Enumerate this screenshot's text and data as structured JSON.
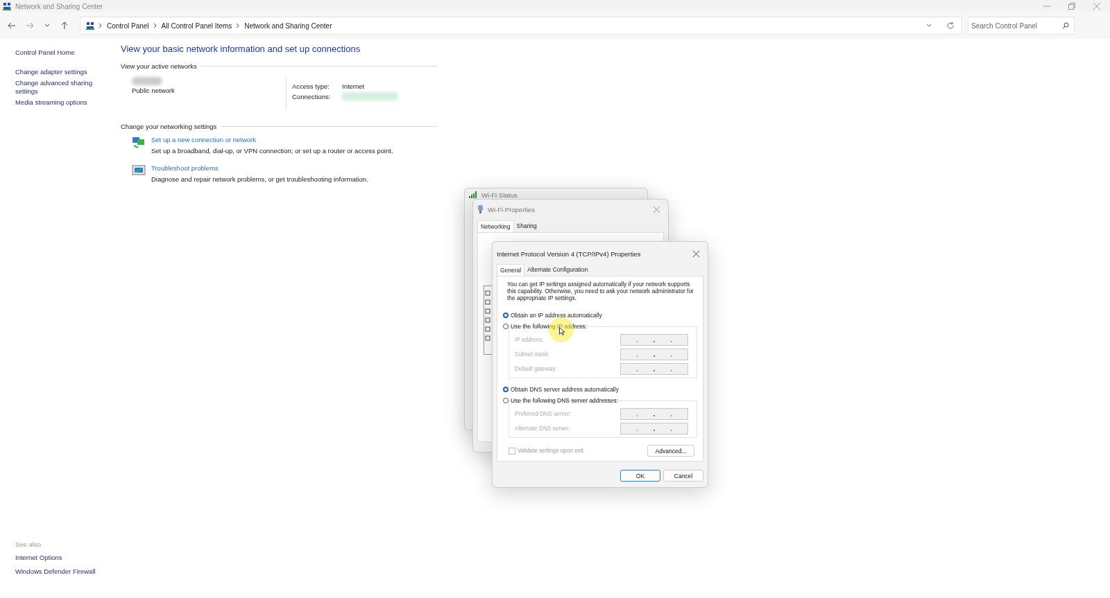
{
  "window": {
    "title": "Network and Sharing Center"
  },
  "address_bar": {
    "breadcrumbs": [
      "Control Panel",
      "All Control Panel Items",
      "Network and Sharing Center"
    ],
    "search": {
      "placeholder": "Search Control Panel"
    }
  },
  "sidebar": {
    "items": [
      {
        "label": "Control Panel Home"
      },
      {
        "label": "Change adapter settings"
      },
      {
        "label": "Change advanced sharing settings"
      },
      {
        "label": "Media streaming options"
      }
    ],
    "see_also": {
      "heading": "See also",
      "items": [
        {
          "label": "Internet Options"
        },
        {
          "label": "Windows Defender Firewall"
        }
      ]
    }
  },
  "main": {
    "heading": "View your basic network information and set up connections",
    "active_networks": {
      "label": "View your active networks",
      "network_type": "Public network",
      "access_type_label": "Access type:",
      "access_type": "Internet",
      "connections_label": "Connections:"
    },
    "change_settings": {
      "label": "Change your networking settings",
      "tasks": [
        {
          "kind": "connection",
          "title": "Set up a new connection or network",
          "description": "Set up a broadband, dial-up, or VPN connection; or set up a router or access point."
        },
        {
          "kind": "troubleshoot",
          "title": "Troubleshoot problems",
          "description": "Diagnose and repair network problems, or get troubleshooting information."
        }
      ]
    }
  },
  "wifi_status": {
    "title": "Wi-Fi Status"
  },
  "wifi_properties": {
    "title": "Wi-Fi Properties",
    "tabs": [
      {
        "label": "Networking",
        "selected": true
      },
      {
        "label": "Sharing",
        "selected": false
      }
    ]
  },
  "ipv4_dialog": {
    "title": "Internet Protocol Version 4 (TCP/IPv4) Properties",
    "tabs": [
      {
        "label": "General",
        "selected": true
      },
      {
        "label": "Alternate Configuration",
        "selected": false
      }
    ],
    "intro": "You can get IP settings assigned automatically if your network supports this capability. Otherwise, you need to ask your network administrator for the appropriate IP settings.",
    "ip_options": [
      {
        "label": "Obtain an IP address automatically",
        "selected": true
      },
      {
        "label": "Use the following IP address:",
        "selected": false
      }
    ],
    "ip_fields": [
      {
        "label": "IP address:",
        "disabled": true
      },
      {
        "label": "Subnet mask:",
        "disabled": true
      },
      {
        "label": "Default gateway:",
        "disabled": true
      }
    ],
    "dns_options": [
      {
        "label": "Obtain DNS server address automatically",
        "selected": true
      },
      {
        "label": "Use the following DNS server addresses:",
        "selected": false
      }
    ],
    "dns_fields": [
      {
        "label": "Preferred DNS server:",
        "disabled": true
      },
      {
        "label": "Alternate DNS server:",
        "disabled": true
      }
    ],
    "validate": {
      "label": "Validate settings upon exit",
      "checked": false,
      "disabled": true
    },
    "advanced_button": "Advanced...",
    "buttons": [
      {
        "label": "OK",
        "default": true
      },
      {
        "label": "Cancel",
        "default": false
      }
    ]
  }
}
